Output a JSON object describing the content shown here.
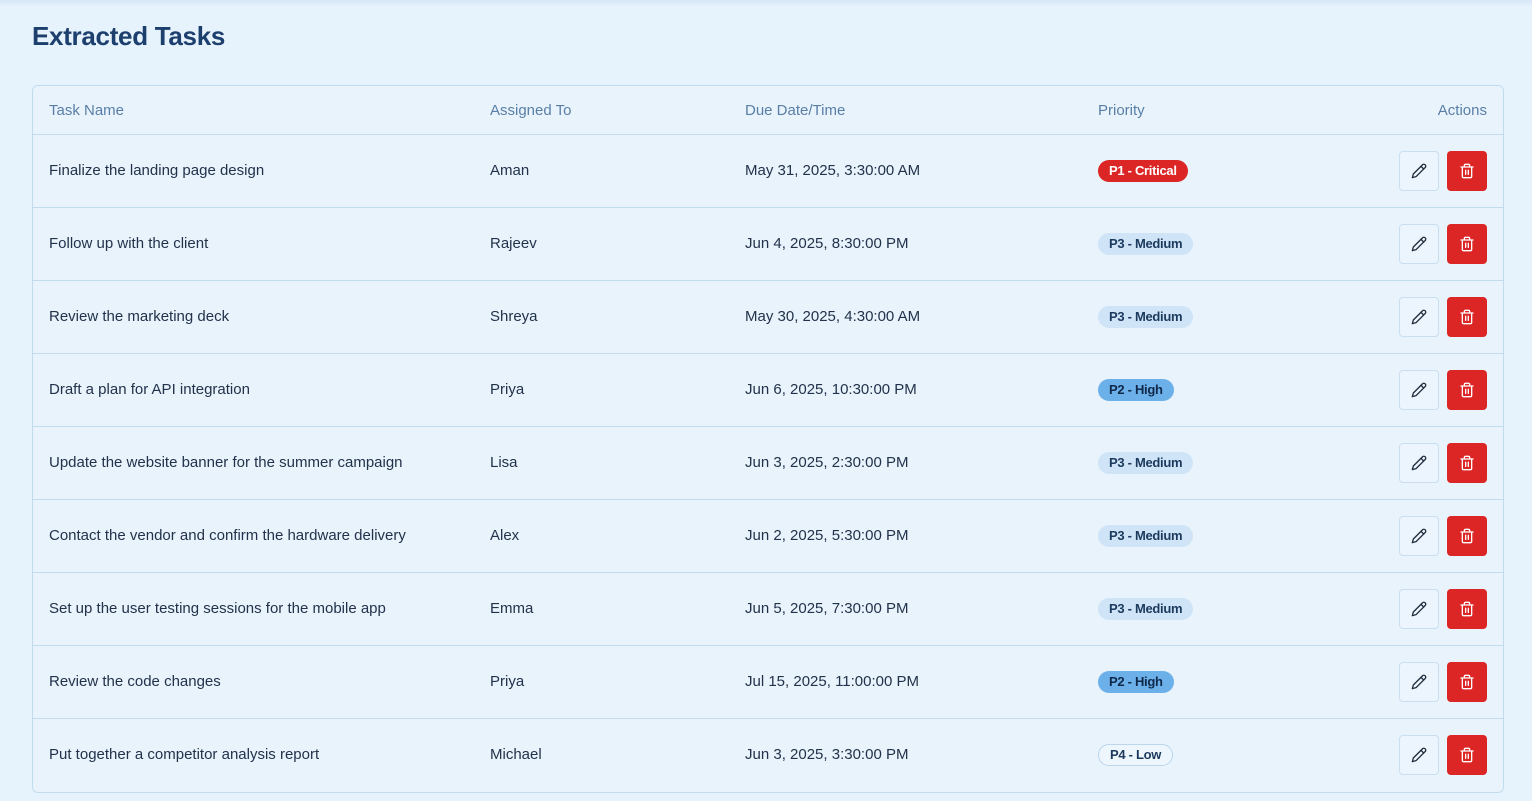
{
  "page": {
    "title": "Extracted Tasks"
  },
  "table": {
    "headers": {
      "task": "Task Name",
      "assigned": "Assigned To",
      "due": "Due Date/Time",
      "priority": "Priority",
      "actions": "Actions"
    },
    "rows": [
      {
        "task": "Finalize the landing page design",
        "assigned": "Aman",
        "due": "May 31, 2025, 3:30:00 AM",
        "priority": "P1 - Critical",
        "level": "critical"
      },
      {
        "task": "Follow up with the client",
        "assigned": "Rajeev",
        "due": "Jun 4, 2025, 8:30:00 PM",
        "priority": "P3 - Medium",
        "level": "medium"
      },
      {
        "task": "Review the marketing deck",
        "assigned": "Shreya",
        "due": "May 30, 2025, 4:30:00 AM",
        "priority": "P3 - Medium",
        "level": "medium"
      },
      {
        "task": "Draft a plan for API integration",
        "assigned": "Priya",
        "due": "Jun 6, 2025, 10:30:00 PM",
        "priority": "P2 - High",
        "level": "high"
      },
      {
        "task": "Update the website banner for the summer campaign",
        "assigned": "Lisa",
        "due": "Jun 3, 2025, 2:30:00 PM",
        "priority": "P3 - Medium",
        "level": "medium"
      },
      {
        "task": "Contact the vendor and confirm the hardware delivery",
        "assigned": "Alex",
        "due": "Jun 2, 2025, 5:30:00 PM",
        "priority": "P3 - Medium",
        "level": "medium"
      },
      {
        "task": "Set up the user testing sessions for the mobile app",
        "assigned": "Emma",
        "due": "Jun 5, 2025, 7:30:00 PM",
        "priority": "P3 - Medium",
        "level": "medium"
      },
      {
        "task": "Review the code changes",
        "assigned": "Priya",
        "due": "Jul 15, 2025, 11:00:00 PM",
        "priority": "P2 - High",
        "level": "high"
      },
      {
        "task": "Put together a competitor analysis report",
        "assigned": "Michael",
        "due": "Jun 3, 2025, 3:30:00 PM",
        "priority": "P4 - Low",
        "level": "low"
      }
    ]
  },
  "icons": {
    "edit": "pencil-icon",
    "delete": "trash-icon"
  },
  "colors": {
    "critical": "#dc2626",
    "high": "#6cb0ea",
    "medium": "#cfe4f6",
    "title": "#1c3f6e"
  }
}
